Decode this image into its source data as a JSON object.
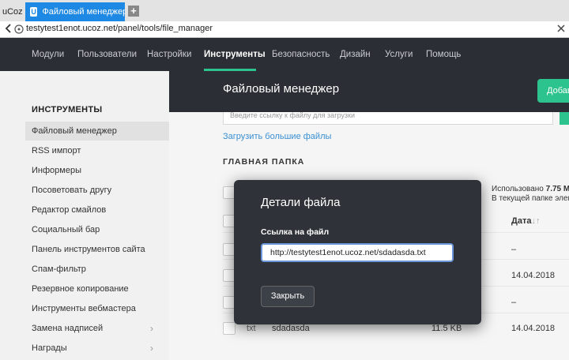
{
  "browser": {
    "inactive_tab": "uCoz",
    "active_tab": "Файловый менеджер – Ин",
    "favicon_letter": "U",
    "new_tab": "+",
    "url": "testytest1enot.ucoz.net/panel/tools/file_manager"
  },
  "topnav": {
    "items": [
      "Модули",
      "Пользователи",
      "Настройки",
      "Инструменты",
      "Безопасность",
      "Дизайн",
      "Услуги",
      "Помощь"
    ],
    "active": "Инструменты"
  },
  "sidebar": {
    "title": "ИНСТРУМЕНТЫ",
    "items": [
      "Файловый менеджер",
      "RSS импорт",
      "Информеры",
      "Посоветовать другу",
      "Редактор смайлов",
      "Социальный бар",
      "Панель инструментов сайта",
      "Спам-фильтр",
      "Резервное копирование",
      "Инструменты вебмастера",
      "Замена надписей",
      "Награды"
    ],
    "arrow": "›"
  },
  "content": {
    "title": "Файловый менеджер",
    "add_button": "Добав",
    "upload_placeholder": "Введите ссылку к файлу для загрузки",
    "upload_more": "Загрузить большие файлы",
    "section_title": "ГЛАВНАЯ ПАПКА",
    "usage_prefix": "Использовано",
    "usage_value": "7.75 Mb",
    "usage_line2": "В текущей папке элем",
    "date_header": "Дата",
    "date_sort": "↓↑",
    "rows": [
      {
        "date": "–"
      },
      {
        "date": "14.04.2018"
      },
      {
        "date": "–"
      },
      {
        "ext": "txt",
        "name": "sdadasda",
        "size": "11.5 KB",
        "date": "14.04.2018"
      }
    ]
  },
  "modal": {
    "title": "Детали файла",
    "label": "Ссылка на файл",
    "link_value": "http://testytest1enot.ucoz.net/sdadasda.txt",
    "close_button": "Закрыть"
  },
  "colors": {
    "accent": "#2cc38f",
    "nav_bg": "#2b2e34",
    "tab_blue": "#1e88e5",
    "link_blue": "#3a8fd4"
  }
}
